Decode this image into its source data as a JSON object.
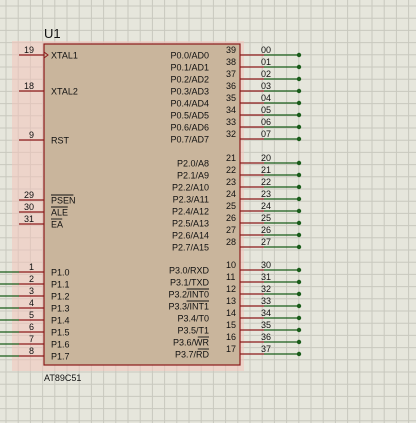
{
  "component": {
    "reference": "U1",
    "part": "AT89C51",
    "colors": {
      "background": "#e6e6dc",
      "grid": "#c8c8be",
      "body_fill": "#c9b59c",
      "highlight": "#f2c4bc",
      "outline": "#8b1a1a",
      "pin_number": "#111111",
      "pin_name": "#111111",
      "wire": "#1a5c1a",
      "net_label": "#111111"
    }
  },
  "left_pins": [
    {
      "num": "19",
      "name": "XTAL1",
      "overline": false,
      "clock": true,
      "wired": false
    },
    {
      "num": "18",
      "name": "XTAL2",
      "overline": false,
      "clock": false,
      "wired": false
    },
    {
      "num": "9",
      "name": "RST",
      "overline": false,
      "clock": false,
      "wired": false
    },
    {
      "num": "29",
      "name": "PSEN",
      "overline": true,
      "clock": false,
      "wired": false
    },
    {
      "num": "30",
      "name": "ALE",
      "overline": true,
      "clock": false,
      "wired": false
    },
    {
      "num": "31",
      "name": "EA",
      "overline": true,
      "clock": false,
      "wired": false
    },
    {
      "num": "1",
      "name": "P1.0",
      "overline": false,
      "clock": false,
      "wired": true
    },
    {
      "num": "2",
      "name": "P1.1",
      "overline": false,
      "clock": false,
      "wired": true
    },
    {
      "num": "3",
      "name": "P1.2",
      "overline": false,
      "clock": false,
      "wired": true
    },
    {
      "num": "4",
      "name": "P1.3",
      "overline": false,
      "clock": false,
      "wired": true
    },
    {
      "num": "5",
      "name": "P1.4",
      "overline": false,
      "clock": false,
      "wired": true
    },
    {
      "num": "6",
      "name": "P1.5",
      "overline": false,
      "clock": false,
      "wired": true
    },
    {
      "num": "7",
      "name": "P1.6",
      "overline": false,
      "clock": false,
      "wired": true
    },
    {
      "num": "8",
      "name": "P1.7",
      "overline": false,
      "clock": false,
      "wired": true
    }
  ],
  "right_pins": [
    {
      "num": "39",
      "name": "P0.0/AD0",
      "net": "00"
    },
    {
      "num": "38",
      "name": "P0.1/AD1",
      "net": "01"
    },
    {
      "num": "37",
      "name": "P0.2/AD2",
      "net": "02"
    },
    {
      "num": "36",
      "name": "P0.3/AD3",
      "net": "03"
    },
    {
      "num": "35",
      "name": "P0.4/AD4",
      "net": "04"
    },
    {
      "num": "34",
      "name": "P0.5/AD5",
      "net": "05"
    },
    {
      "num": "33",
      "name": "P0.6/AD6",
      "net": "06"
    },
    {
      "num": "32",
      "name": "P0.7/AD7",
      "net": "07"
    },
    {
      "num": "21",
      "name": "P2.0/A8",
      "net": "20"
    },
    {
      "num": "22",
      "name": "P2.1/A9",
      "net": "21"
    },
    {
      "num": "23",
      "name": "P2.2/A10",
      "net": "22"
    },
    {
      "num": "24",
      "name": "P2.3/A11",
      "net": "23"
    },
    {
      "num": "25",
      "name": "P2.4/A12",
      "net": "24"
    },
    {
      "num": "26",
      "name": "P2.5/A13",
      "net": "25"
    },
    {
      "num": "27",
      "name": "P2.6/A14",
      "net": "26"
    },
    {
      "num": "28",
      "name": "P2.7/A15",
      "net": "27"
    },
    {
      "num": "10",
      "name": "P3.0/RXD",
      "overline_part": "",
      "net": "30"
    },
    {
      "num": "11",
      "name": "P3.1/TXD",
      "overline_part": "",
      "net": "31"
    },
    {
      "num": "12",
      "name": "P3.2/INT0",
      "overline_part": "INT0",
      "net": "32"
    },
    {
      "num": "13",
      "name": "P3.3/INT1",
      "overline_part": "INT1",
      "net": "33"
    },
    {
      "num": "14",
      "name": "P3.4/T0",
      "overline_part": "",
      "net": "34"
    },
    {
      "num": "15",
      "name": "P3.5/T1",
      "overline_part": "",
      "net": "35"
    },
    {
      "num": "16",
      "name": "P3.6/WR",
      "overline_part": "WR",
      "net": "36"
    },
    {
      "num": "17",
      "name": "P3.7/RD",
      "overline_part": "RD",
      "net": "37"
    }
  ]
}
